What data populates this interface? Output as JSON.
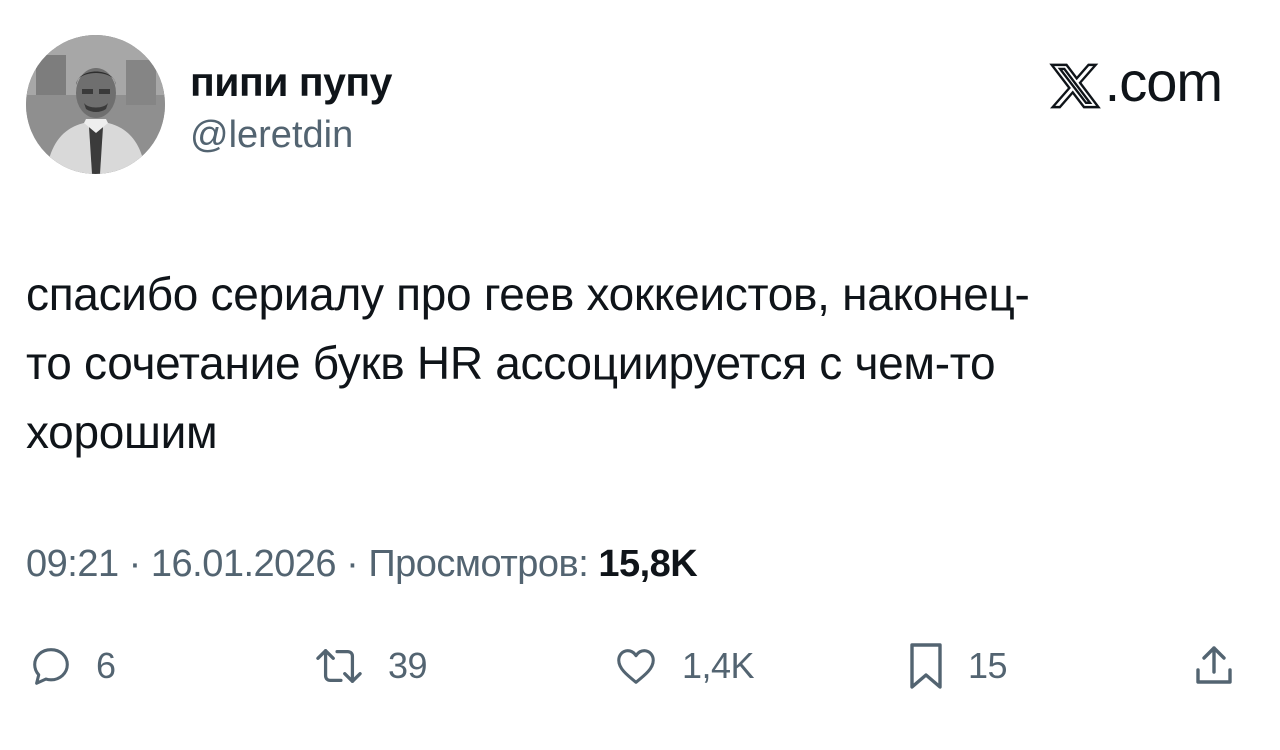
{
  "author": {
    "display_name": "пипи пупу",
    "handle": "@leretdin",
    "avatar_icon": "avatar-photo"
  },
  "brand": {
    "text": ".com",
    "icon": "x-logo-icon"
  },
  "tweet": {
    "line1": "спасибо сериалу про геев хоккеистов, наконец-",
    "line2": "то сочетание букв HR ассоциируется с чем-то",
    "line3": "хорошим"
  },
  "meta": {
    "time": "09:21",
    "separator": "·",
    "date": "16.01.2026",
    "views_label": "Просмотров:",
    "views_count": "15,8K"
  },
  "actions": {
    "reply": {
      "icon": "reply-icon",
      "count": "6"
    },
    "retweet": {
      "icon": "retweet-icon",
      "count": "39"
    },
    "like": {
      "icon": "heart-icon",
      "count": "1,4K"
    },
    "bookmark": {
      "icon": "bookmark-icon",
      "count": "15"
    },
    "share": {
      "icon": "share-icon"
    }
  },
  "colors": {
    "text_primary": "#0f1419",
    "text_secondary": "#536471",
    "background": "#ffffff"
  }
}
